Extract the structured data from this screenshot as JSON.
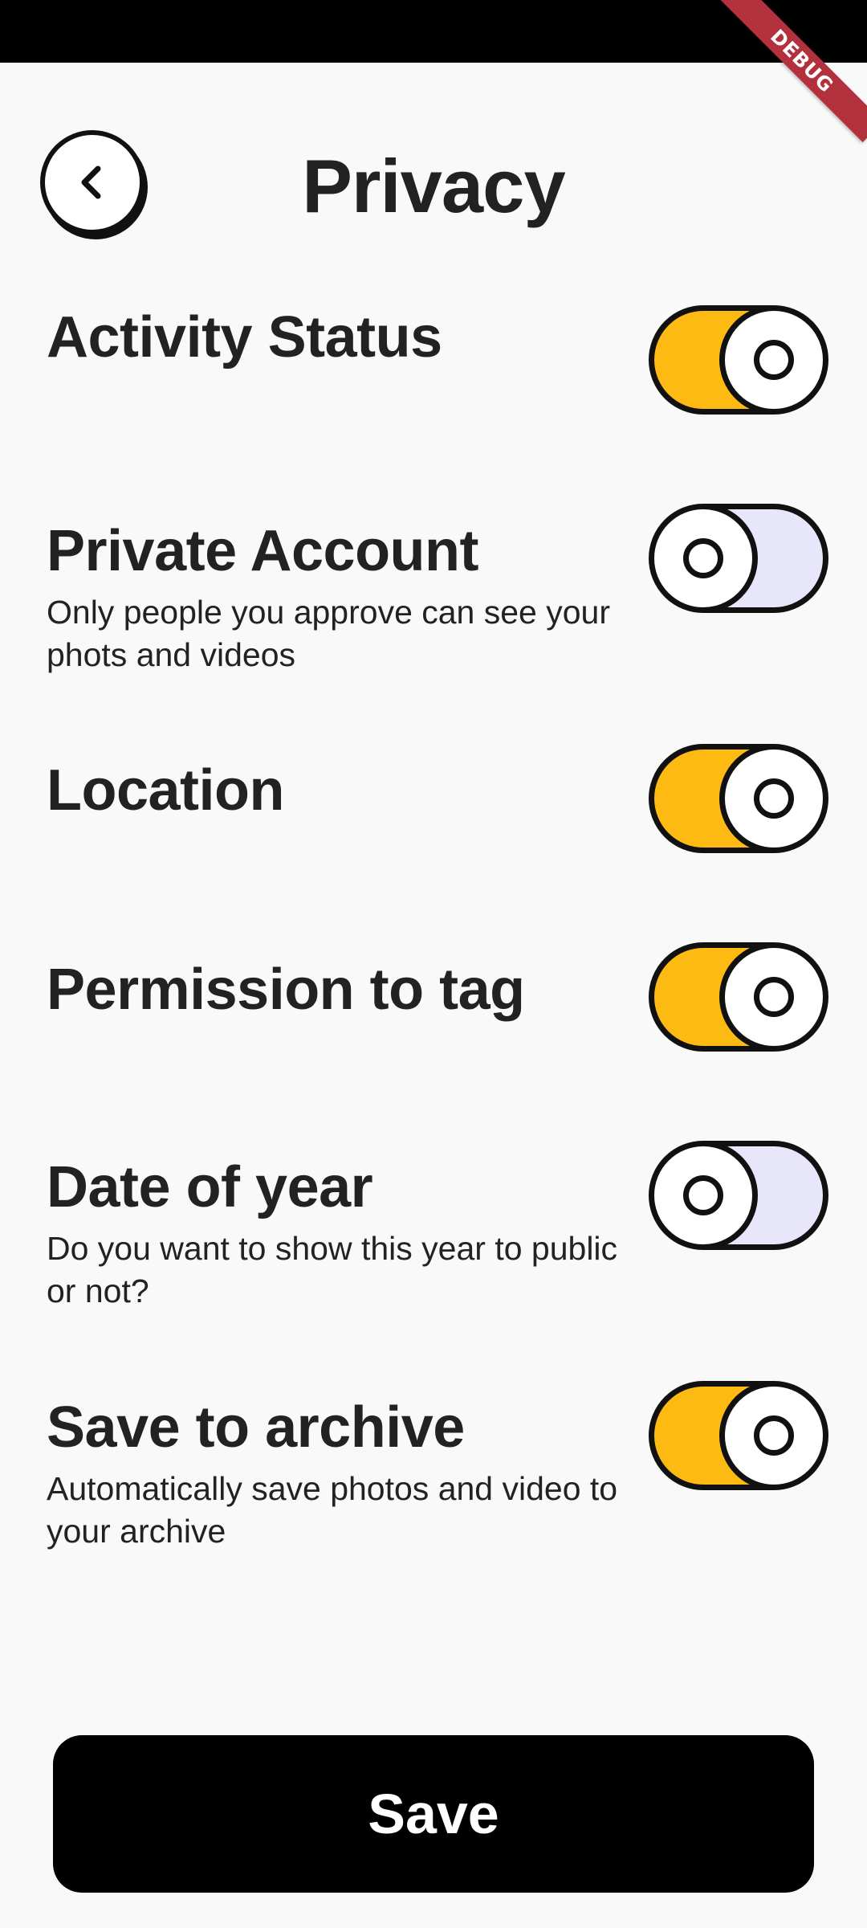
{
  "status_bar": {},
  "debug_banner": "DEBUG",
  "header": {
    "back_icon": "chevron-left-icon",
    "title": "Privacy"
  },
  "settings": [
    {
      "title": "Activity Status",
      "description": "",
      "enabled": true
    },
    {
      "title": "Private Account",
      "description": "Only people you approve can see your phots and videos",
      "enabled": false
    },
    {
      "title": "Location",
      "description": "",
      "enabled": true
    },
    {
      "title": "Permission to tag",
      "description": "",
      "enabled": true
    },
    {
      "title": "Date of year",
      "description": "Do you want to show this year to public or not?",
      "enabled": false
    },
    {
      "title": "Save to archive",
      "description": "Automatically save photos and video to your archive",
      "enabled": true
    }
  ],
  "save_button": {
    "label": "Save"
  },
  "colors": {
    "background": "#f9f9f9",
    "toggle_on": "#fdba12",
    "toggle_off": "#e8e6fb",
    "outline": "#111111",
    "debug_ribbon": "#b3313d",
    "save_button": "#000000"
  }
}
